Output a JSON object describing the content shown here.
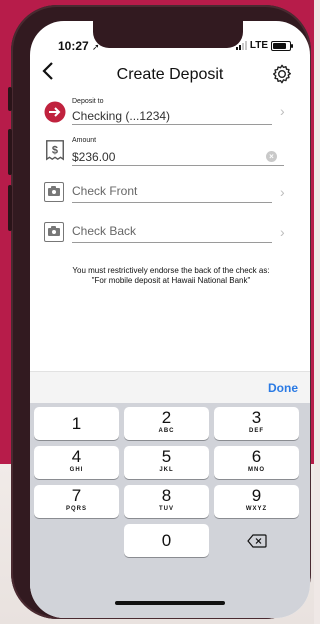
{
  "status_bar": {
    "time": "10:27",
    "network": "LTE"
  },
  "nav": {
    "title": "Create Deposit",
    "back_icon": "chevron-left-icon",
    "settings_icon": "gear-icon"
  },
  "form": {
    "deposit_to": {
      "label": "Deposit to",
      "value": "Checking  (...1234)",
      "icon_color": "#c0223e"
    },
    "amount": {
      "label": "Amount",
      "value": "$236.00"
    },
    "check_front": {
      "placeholder": "Check Front"
    },
    "check_back": {
      "placeholder": "Check Back"
    }
  },
  "notice": "You must restrictively endorse the back of the check as: \"For mobile deposit at Hawaii National Bank\"",
  "keyboard": {
    "done_label": "Done",
    "done_color": "#2a7ae4",
    "keys": [
      {
        "num": "1",
        "letters": ""
      },
      {
        "num": "2",
        "letters": "ABC"
      },
      {
        "num": "3",
        "letters": "DEF"
      },
      {
        "num": "4",
        "letters": "GHI"
      },
      {
        "num": "5",
        "letters": "JKL"
      },
      {
        "num": "6",
        "letters": "MNO"
      },
      {
        "num": "7",
        "letters": "PQRS"
      },
      {
        "num": "8",
        "letters": "TUV"
      },
      {
        "num": "9",
        "letters": "WXYZ"
      },
      {
        "num": "0",
        "letters": ""
      }
    ],
    "backspace_icon": "backspace-icon"
  },
  "colors": {
    "background_top": "#b71c4a",
    "phone_frame": "#321a20"
  }
}
